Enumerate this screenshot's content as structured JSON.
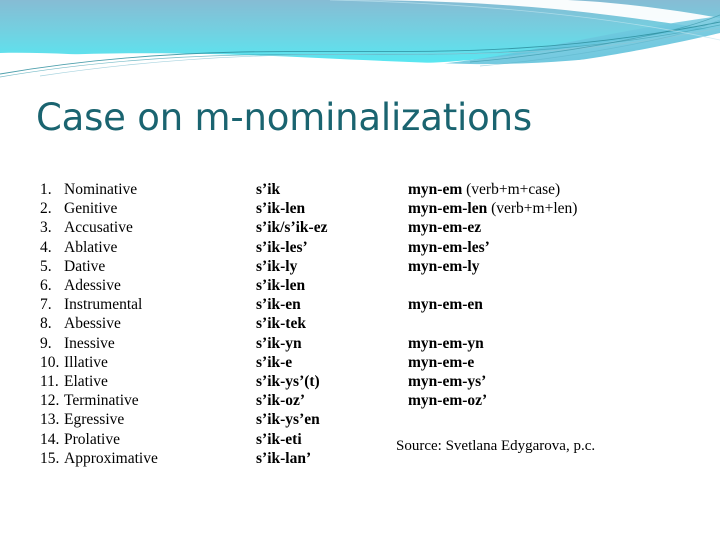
{
  "slide": {
    "title": "Case on m-nominalizations",
    "accent_color": "#1a6470",
    "highlight_color": "#a02828",
    "banner_color_top": "#7fc0d8",
    "banner_color_bottom": "#5fe4ef"
  },
  "table": {
    "rows": [
      {
        "num": "1.",
        "name": "Nominative",
        "form": "s’ik",
        "nominalization": "myn-em",
        "note": "(verb+m+case)",
        "highlight": false
      },
      {
        "num": "2.",
        "name": "Genitive",
        "form": "s’ik-len",
        "nominalization": "myn-em-len",
        "note": "(verb+m+len)",
        "highlight": false
      },
      {
        "num": "3.",
        "name": "Accusative",
        "form": "s’ik/s’ik-ez",
        "nominalization": "myn-em-ez",
        "note": "",
        "highlight": false
      },
      {
        "num": "4.",
        "name": "Ablative",
        "form": "s’ik-les’",
        "nominalization": "myn-em-les’",
        "note": "",
        "highlight": true
      },
      {
        "num": "5.",
        "name": "Dative",
        "form": "s’ik-ly",
        "nominalization": "myn-em-ly",
        "note": "",
        "highlight": false
      },
      {
        "num": "6.",
        "name": "Adessive",
        "form": "s’ik-len",
        "nominalization": "",
        "note": "",
        "highlight": false
      },
      {
        "num": "7.",
        "name": "Instrumental",
        "form": "s’ik-en",
        "nominalization": "myn-em-en",
        "note": "",
        "highlight": false
      },
      {
        "num": "8.",
        "name": "Abessive",
        "form": "s’ik-tek",
        "nominalization": "",
        "note": "",
        "highlight": false
      },
      {
        "num": "9.",
        "name": "Inessive",
        "form": "s’ik-yn",
        "nominalization": "myn-em-yn",
        "note": "",
        "highlight": false
      },
      {
        "num": "10.",
        "name": "Illative",
        "form": "s’ik-e",
        "nominalization": "myn-em-e",
        "note": "",
        "highlight": false
      },
      {
        "num": "11.",
        "name": "Elative",
        "form": "s’ik-ys’(t)",
        "nominalization": "myn-em-ys’",
        "note": "",
        "highlight": true
      },
      {
        "num": "12.",
        "name": "Terminative",
        "form": "s’ik-oz’",
        "nominalization": "myn-em-oz’",
        "note": "",
        "highlight": false
      },
      {
        "num": "13.",
        "name": "Egressive",
        "form": "s’ik-ys’en",
        "nominalization": "",
        "note": "",
        "highlight": true
      },
      {
        "num": "14.",
        "name": "Prolative",
        "form": "s’ik-eti",
        "nominalization": "",
        "note": "",
        "highlight": false
      },
      {
        "num": "15.",
        "name": "Approximative",
        "form": "s’ik-lan’",
        "nominalization": "",
        "note": "",
        "highlight": false
      }
    ]
  },
  "source": {
    "text": "Source: Svetlana Edygarova, p.c."
  }
}
